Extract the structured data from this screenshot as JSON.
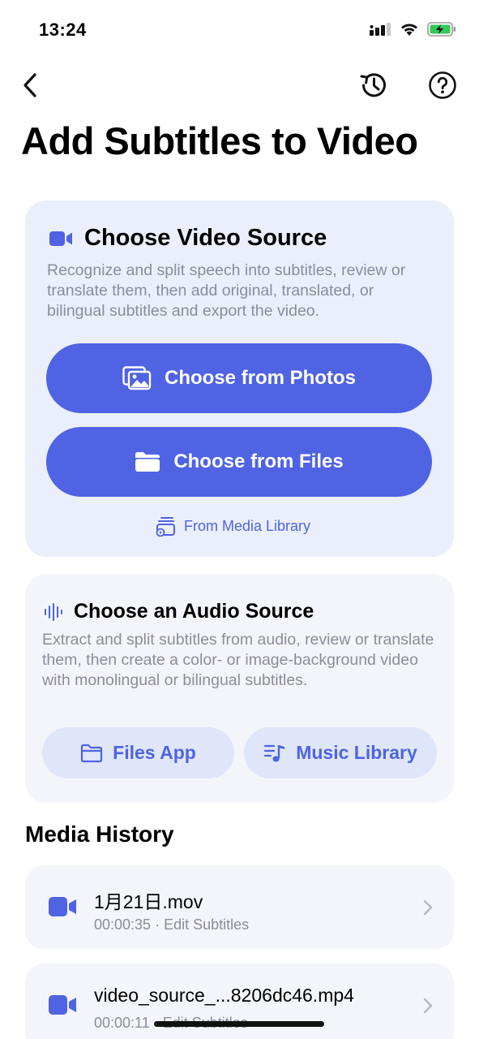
{
  "status": {
    "time": "13:24"
  },
  "nav": {
    "back": "back",
    "history": "history",
    "help": "help"
  },
  "page_title": "Add Subtitles to Video",
  "video_card": {
    "title": "Choose Video Source",
    "description": "Recognize and split speech into subtitles, review or translate them, then add original, translated, or bilingual subtitles and export the video.",
    "photos_button": "Choose from Photos",
    "files_button": "Choose from Files",
    "media_library_link": "From Media Library"
  },
  "audio_card": {
    "title": "Choose an Audio Source",
    "description": "Extract and split subtitles from audio, review or translate them, then create a color- or image-background video with monolingual or bilingual subtitles.",
    "files_app_button": "Files App",
    "music_library_button": "Music Library"
  },
  "media_history": {
    "title": "Media History",
    "items": [
      {
        "name": "1月21日.mov",
        "meta": "00:00:35 · Edit Subtitles"
      },
      {
        "name": "video_source_...8206dc46.mp4",
        "meta": "00:00:11 · Edit Subtitles"
      }
    ]
  },
  "colors": {
    "accent": "#4f63e3",
    "card_bg": "#eaeffb",
    "secondary_text": "#8a8e99",
    "battery": "#34c759"
  },
  "icons": [
    "signal-icon",
    "wifi-icon",
    "battery-icon",
    "back-chevron-icon",
    "history-icon",
    "help-icon",
    "video-camera-icon",
    "photos-icon",
    "folder-icon",
    "media-library-icon",
    "waveform-icon",
    "music-list-icon",
    "chevron-right-icon"
  ]
}
